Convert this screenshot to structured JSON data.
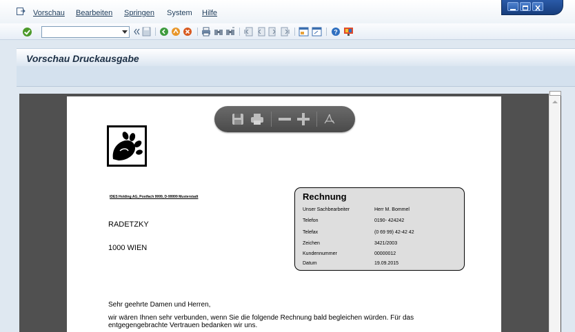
{
  "menu": {
    "items": [
      {
        "label": "Vorschau"
      },
      {
        "label": "Bearbeiten"
      },
      {
        "label": "Springen"
      },
      {
        "label": "System"
      },
      {
        "label": "Hilfe"
      }
    ]
  },
  "toolbar": {
    "command_value": ""
  },
  "title": "Vorschau Druckausgabe",
  "document": {
    "sender_line": "IDES Holding AG, Postfach 9999, D-99999 Musterstadt",
    "recipient_name": "RADETZKY",
    "recipient_city": "1000 WIEN",
    "invoice": {
      "title": "Rechnung",
      "rows": [
        {
          "label": "Unser Sachbearbeiter",
          "value": "Herr M. Bommel"
        },
        {
          "label": "Telefon",
          "value": "0190- 424242"
        },
        {
          "label": "Telefax",
          "value": "(0 69 99) 42-42 42"
        },
        {
          "label": "Zeichen",
          "value": "3421/2003"
        },
        {
          "label": "Kundennummer",
          "value": "00000012"
        },
        {
          "label": "Datum",
          "value": "19.09.2015"
        }
      ]
    },
    "salutation": "Sehr geehrte Damen und Herren,",
    "body_line1": "wir wären Ihnen sehr verbunden, wenn Sie die folgende Rechnung bald begleichen würden. Für das",
    "body_line2": "entgegengebrachte Vertrauen bedanken wir uns."
  },
  "colors": {
    "accent": "#2a5aa8",
    "viewer_bg": "#505050",
    "title_text": "#1c2f45"
  },
  "icons": [
    "menu-icon",
    "ok-icon",
    "back-icon",
    "save-icon",
    "exit-icon",
    "cancel-icon",
    "print-icon",
    "find-icon",
    "page-icons",
    "help-icon",
    "customize-icon",
    "pdf-save-icon",
    "pdf-print-icon",
    "zoom-out-icon",
    "zoom-in-icon",
    "acrobat-icon"
  ]
}
